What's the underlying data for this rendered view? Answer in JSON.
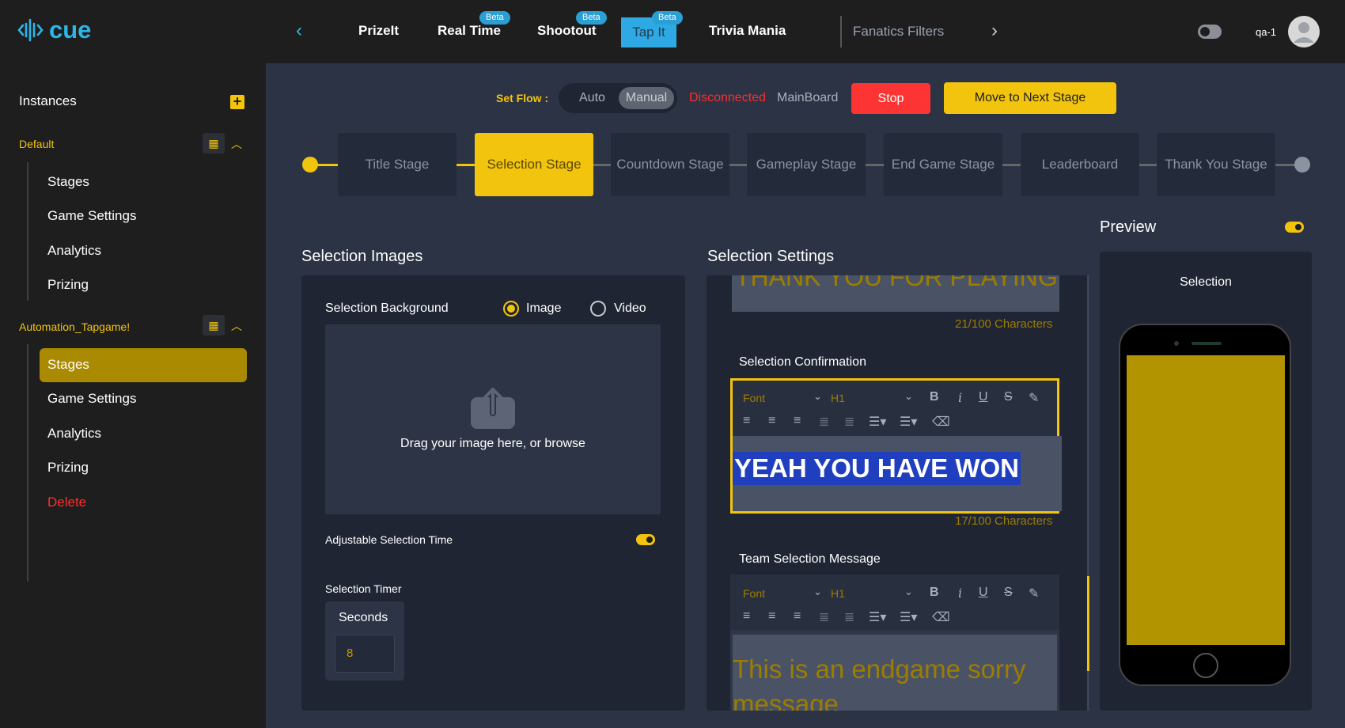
{
  "app": {
    "logo_text": "cue",
    "brand_color": "#2fb4e6",
    "accent_color": "#f2c40d"
  },
  "topnav": {
    "items": [
      {
        "label": "PrizeIt",
        "beta": ""
      },
      {
        "label": "Real Time",
        "beta": "Beta"
      },
      {
        "label": "Shootout",
        "beta": "Beta"
      },
      {
        "label": "Tap It",
        "beta": "Beta",
        "active": true
      },
      {
        "label": "Trivia Mania",
        "beta": ""
      }
    ],
    "filter_label": "Fanatics Filters",
    "user": "qa-1",
    "icons": {
      "prev": "chevron-left-icon",
      "next": "chevron-right-icon",
      "theme": "theme-toggle-icon",
      "avatar": "user-avatar-icon"
    }
  },
  "sidebar": {
    "title": "Instances",
    "groups": [
      {
        "name": "Default",
        "items": [
          "Stages",
          "Game Settings",
          "Analytics",
          "Prizing"
        ]
      },
      {
        "name": "Automation_Tapgame!",
        "items": [
          "Stages",
          "Game Settings",
          "Analytics",
          "Prizing"
        ],
        "delete": "Delete",
        "active_item": "Stages"
      }
    ]
  },
  "flow": {
    "label": "Set Flow :",
    "auto": "Auto",
    "manual": "Manual",
    "mode": "Manual",
    "status": "Disconnected",
    "board": "MainBoard",
    "stop": "Stop",
    "next": "Move to Next Stage"
  },
  "stages": {
    "items": [
      "Title Stage",
      "Selection Stage",
      "Countdown Stage",
      "Gameplay Stage",
      "End Game Stage",
      "Leaderboard",
      "Thank You Stage"
    ],
    "active": "Selection Stage"
  },
  "images_panel": {
    "title": "Selection Images",
    "background_label": "Selection Background",
    "opt_image": "Image",
    "opt_video": "Video",
    "selected": "Image",
    "drop_text": "Drag your image here, or browse",
    "adjustable_label": "Adjustable Selection Time",
    "adjustable_on": true,
    "timer_label": "Selection Timer",
    "seconds_label": "Seconds",
    "seconds_value": "8"
  },
  "settings_panel": {
    "title": "Selection Settings",
    "prev_text": "THANK YOU FOR PLAYING",
    "prev_count": "21/100 Characters",
    "confirmation_label": "Selection Confirmation",
    "confirmation_text": "YEAH YOU HAVE WON",
    "confirmation_count": "17/100 Characters",
    "team_label": "Team Selection Message",
    "team_text": "This is an endgame sorry message",
    "editor": {
      "font": "Font",
      "heading": "H1"
    }
  },
  "preview": {
    "title": "Preview",
    "screen_label": "Selection",
    "enabled": true
  }
}
